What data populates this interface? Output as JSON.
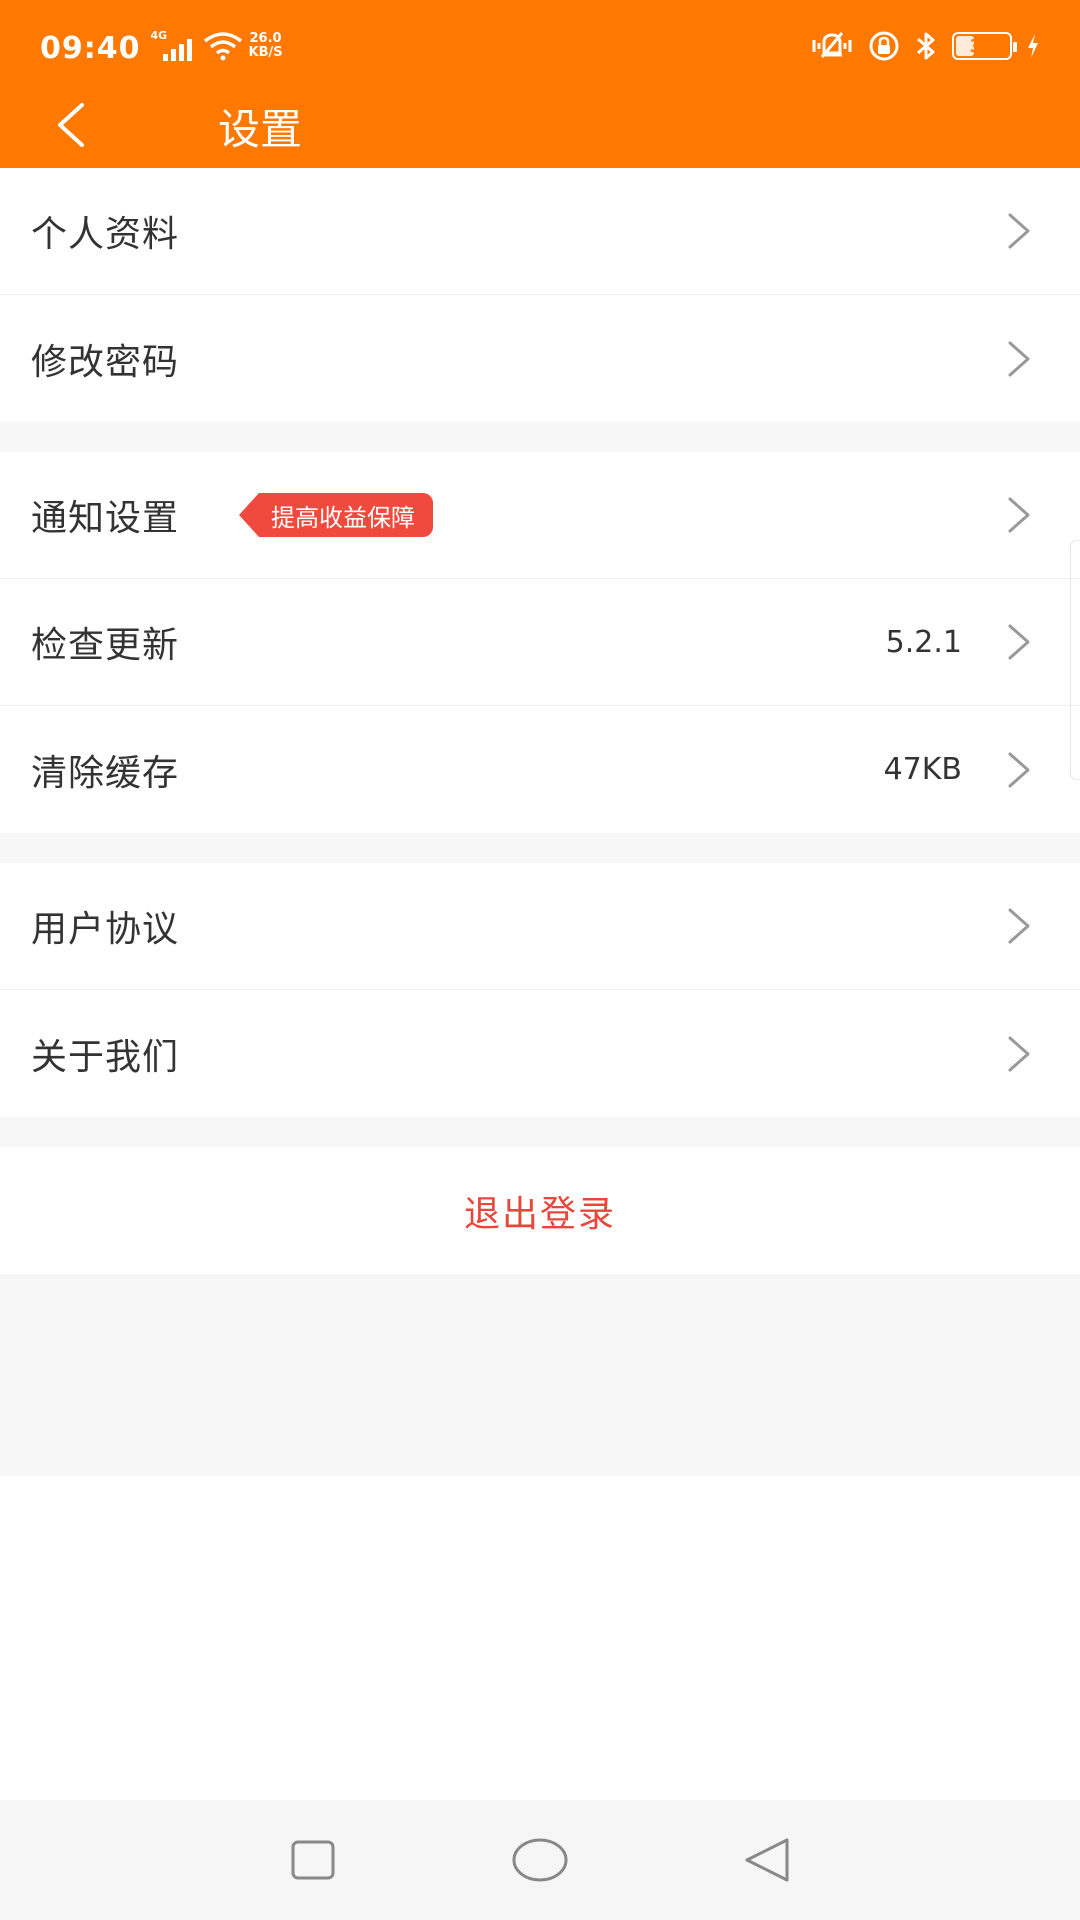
{
  "status_bar": {
    "time": "09:40",
    "network_type": "4G",
    "speed_value": "26.0",
    "speed_unit": "KB/S",
    "battery_level": "35",
    "battery_fraction": 0.35
  },
  "header": {
    "title": "设置"
  },
  "settings": {
    "group1": [
      {
        "label": "个人资料"
      },
      {
        "label": "修改密码"
      }
    ],
    "group2": [
      {
        "label": "通知设置",
        "badge": "提高收益保障"
      },
      {
        "label": "检查更新",
        "value": "5.2.1"
      },
      {
        "label": "清除缓存",
        "value": "47KB"
      }
    ],
    "group3": [
      {
        "label": "用户协议"
      },
      {
        "label": "关于我们"
      }
    ]
  },
  "logout": {
    "label": "退出登录"
  },
  "colors": {
    "brand_orange": "#FF7800",
    "badge_red": "#F04A3E",
    "logout_red": "#E8473B",
    "background_gray": "#F7F7F7"
  },
  "icons": {
    "back": "chevron-left-icon",
    "row_arrow": "chevron-right-icon",
    "recent_apps": "square-icon",
    "home": "circle-icon",
    "back_nav": "triangle-left-icon"
  }
}
